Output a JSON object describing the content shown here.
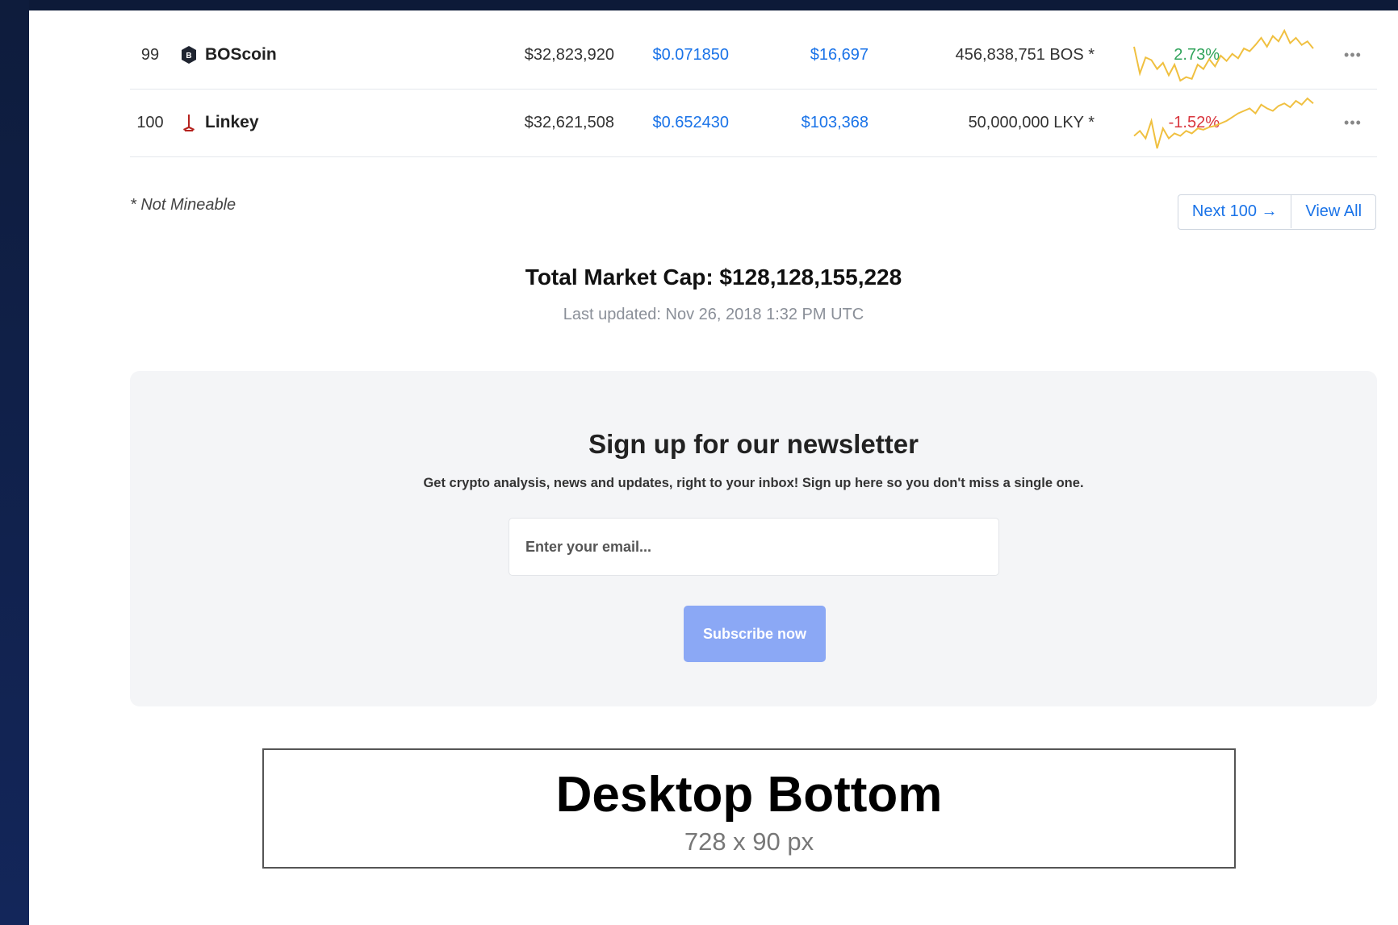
{
  "table": {
    "rows": [
      {
        "rank": "99",
        "icon": "boscoin-hexagon-icon",
        "name": "BOScoin",
        "market_cap": "$32,823,920",
        "price": "$0.071850",
        "volume": "$16,697",
        "supply": "456,838,751 BOS *",
        "change": "2.73%",
        "change_dir": "up",
        "sparkline": [
          60,
          30,
          48,
          45,
          35,
          42,
          28,
          40,
          22,
          26,
          24,
          40,
          35,
          46,
          38,
          50,
          44,
          52,
          47,
          58,
          55,
          62,
          70,
          60,
          72,
          66,
          78,
          64,
          70,
          62,
          66,
          58
        ],
        "more_label": "•••"
      },
      {
        "rank": "100",
        "icon": "linkey-icon",
        "name": "Linkey",
        "market_cap": "$32,621,508",
        "price": "$0.652430",
        "volume": "$103,368",
        "supply": "50,000,000 LKY *",
        "change": "-1.52%",
        "change_dir": "down",
        "sparkline": [
          40,
          44,
          38,
          52,
          30,
          46,
          38,
          42,
          40,
          44,
          42,
          46,
          45,
          47,
          48,
          50,
          52,
          55,
          58,
          60,
          62,
          58,
          65,
          62,
          60,
          64,
          66,
          63,
          68,
          65,
          70,
          66
        ],
        "more_label": "•••"
      }
    ],
    "footnote": "* Not Mineable",
    "pager": {
      "next_label": "Next 100 →",
      "view_all_label": "View All"
    }
  },
  "summary": {
    "total_market_cap": "Total Market Cap: $128,128,155,228",
    "last_updated": "Last updated: Nov 26, 2018 1:32 PM UTC"
  },
  "newsletter": {
    "title": "Sign up for our newsletter",
    "description": "Get crypto analysis, news and updates, right to your inbox! Sign up here so you don't miss a single one.",
    "email_placeholder": "Enter your email...",
    "button_label": "Subscribe now"
  },
  "ad": {
    "title": "Desktop Bottom",
    "size": "728 x 90 px"
  },
  "colors": {
    "link": "#1a73e8",
    "positive": "#2fa35a",
    "negative": "#d9363e",
    "sparkline": "#f0c040",
    "subscribe_button": "#8ba8f5",
    "page_background": "#0f1d3d"
  }
}
